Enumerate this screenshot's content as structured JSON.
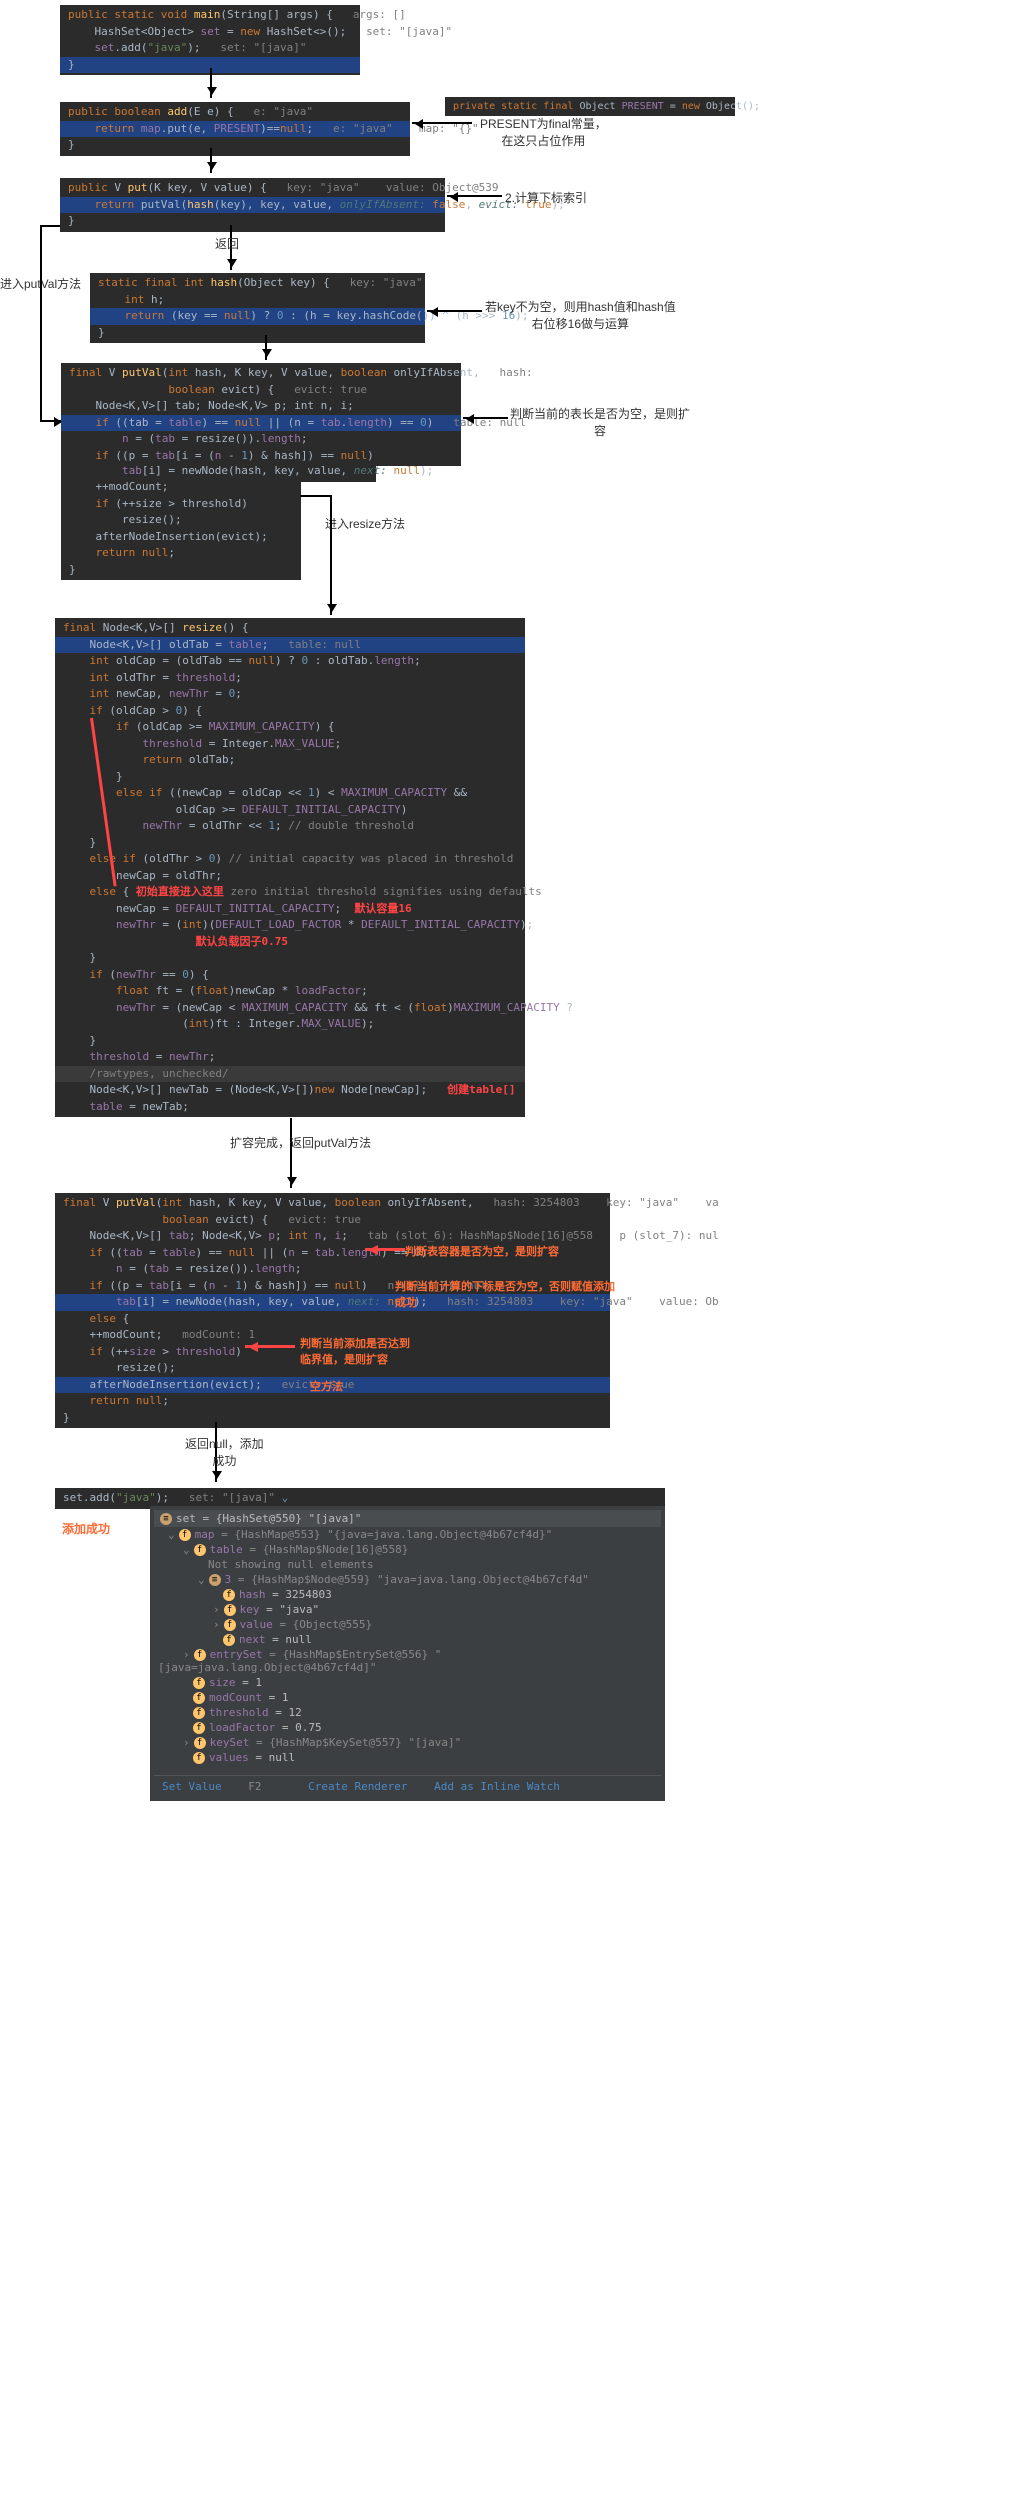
{
  "block1": {
    "l1a": "public static void",
    "l1b": "main",
    "l1c": "(String[] args) {",
    "l1d": "args: []",
    "l2a": "HashSet<Object>",
    "l2b": "set",
    "l2c": " = ",
    "l2d": "new",
    "l2e": " HashSet<>();",
    "l2f": "set: \"[java]\"",
    "l3a": "set",
    "l3b": ".add(",
    "l3c": "\"java\"",
    "l3d": ");",
    "l3e": "set: \"[java]\"",
    "l4": "}"
  },
  "block2": {
    "l1a": "public boolean",
    "l1b": "add",
    "l1c": "(E e) {",
    "l1d": "e: \"java\"",
    "l2a": "return",
    "l2b": "map",
    "l2c": ".put(e, ",
    "l2d": "PRESENT",
    "l2e": ")==",
    "l2f": "null",
    "l2g": ";",
    "l2h": "e: \"java\"    map: \"{}\"",
    "l3": "}"
  },
  "block2b": {
    "l1a": "private static final",
    "l1b": " Object ",
    "l1c": "PRESENT",
    "l1d": " = ",
    "l1e": "new",
    "l1f": " Object();"
  },
  "label2": "PRESENT为final常量，\n在这只占位作用",
  "block3": {
    "l1a": "public",
    "l1b": " V ",
    "l1c": "put",
    "l1d": "(K key, V value) {",
    "l1e": "key: \"java\"    value: Object@539",
    "l2a": "return",
    "l2b": " putVal(",
    "l2c": "hash",
    "l2d": "(key), key, value, ",
    "l2e": "onlyIfAbsent:",
    "l2f": "false",
    "l2g": ", ",
    "l2h": "evict:",
    "l2i": "true",
    "l2j": ");",
    "l3": "}"
  },
  "label3": "2.计算下标索引",
  "label_return": "返回",
  "label_enter_putval": "进入putVal方法",
  "block4": {
    "l1a": "static final int",
    "l1b": "hash",
    "l1c": "(Object key) {",
    "l1d": "key: \"java\"",
    "l2a": "int",
    "l2b": " h;",
    "l3a": "return",
    "l3b": " (key == ",
    "l3c": "null",
    "l3d": ") ? ",
    "l3e": "0",
    "l3f": " : (h = key.hashCode()) ^ (h >>> ",
    "l3g": "16",
    "l3h": ");",
    "l4": "}"
  },
  "label4": "若key不为空，则用hash值和hash值\n右位移16做与运算",
  "block5": {
    "l1a": "final",
    "l1b": " V ",
    "l1c": "putVal",
    "l1d": "(",
    "l1e": "int",
    "l1f": " hash, K key, V value, ",
    "l1g": "boolean",
    "l1h": " onlyIfAbsent,",
    "l1i": "hash:",
    "l2a": "boolean",
    "l2b": " evict) {",
    "l2c": "evict: true",
    "l3": "Node<K,V>[] tab; Node<K,V> p; int n, i;",
    "l4a": "if",
    "l4b": " ((tab = ",
    "l4c": "table",
    "l4d": ") == ",
    "l4e": "null",
    "l4f": " || (n = ",
    "l4g": "tab",
    "l4h": ".",
    "l4i": "length",
    "l4j": ") == ",
    "l4k": "0",
    "l4l": ")",
    "l4m": "table: null",
    "l5a": "n",
    "l5b": " = (",
    "l5c": "tab",
    "l5d": " = resize()).",
    "l5e": "length",
    "l5f": ";",
    "l6a": "if",
    "l6b": " ((p = ",
    "l6c": "tab",
    "l6d": "[i = (",
    "l6e": "n",
    "l6f": " - ",
    "l6g": "1",
    "l6h": ") & hash]) == ",
    "l6i": "null",
    "l6j": ")",
    "l7a": "tab",
    "l7b": "[i] = newNode(hash, key, value, ",
    "l7c": "next:",
    "l7d": "null",
    "l7e": ");",
    "l8": "++modCount;",
    "l9a": "if",
    "l9b": " (++size > threshold)",
    "l10": "resize();",
    "l11": "afterNodeInsertion(evict);",
    "l12a": "return null",
    "l12b": ";",
    "l13": "}"
  },
  "label5": "判断当前的表长是否为空，是则扩\n容",
  "label_enter_resize": "进入resize方法",
  "block6": {
    "l1a": "final",
    "l1b": " Node<K,V>[] ",
    "l1c": "resize",
    "l1d": "() {",
    "l2a": "Node<K,V>[] oldTab = ",
    "l2b": "table",
    "l2c": ";",
    "l2d": "table: null",
    "l3a": "int",
    "l3b": " oldCap = (oldTab == ",
    "l3c": "null",
    "l3d": ") ? ",
    "l3e": "0",
    "l3f": " : oldTab.",
    "l3g": "length",
    "l3h": ";",
    "l4a": "int",
    "l4b": " oldThr = ",
    "l4c": "threshold",
    "l4d": ";",
    "l5a": "int",
    "l5b": " newCap, ",
    "l5c": "newThr",
    "l5d": " = ",
    "l5e": "0",
    "l5f": ";",
    "l6a": "if",
    "l6b": " (oldCap > ",
    "l6c": "0",
    "l6d": ") {",
    "l7a": "if",
    "l7b": " (oldCap >= ",
    "l7c": "MAXIMUM_CAPACITY",
    "l7d": ") {",
    "l8a": "threshold",
    "l8b": " = Integer.",
    "l8c": "MAX_VALUE",
    "l8d": ";",
    "l9a": "return",
    "l9b": " oldTab;",
    "l10": "}",
    "l11a": "else if",
    "l11b": " ((newCap = oldCap << ",
    "l11c": "1",
    "l11d": ") < ",
    "l11e": "MAXIMUM_CAPACITY",
    "l11f": " &&",
    "l12a": "oldCap >= ",
    "l12b": "DEFAULT_INITIAL_CAPACITY",
    "l12c": ")",
    "l13a": "newThr",
    "l13b": " = oldThr << ",
    "l13c": "1",
    "l13d": "; ",
    "l13e": "// double threshold",
    "l14": "}",
    "l15a": "else if",
    "l15b": " (oldThr > ",
    "l15c": "0",
    "l15d": ") ",
    "l15e": "// initial capacity was placed in threshold",
    "l16": "newCap = oldThr;",
    "l17a": "else",
    "l17b": " {",
    "l17c": "初始直接进入这里",
    "l17d": "zero initial threshold signifies using defaults",
    "l18a": "newCap = ",
    "l18b": "DEFAULT_INITIAL_CAPACITY",
    "l18c": ";",
    "l18d": "默认容量16",
    "l19a": "newThr",
    "l19b": " = (",
    "l19c": "int",
    "l19d": ")(",
    "l19e": "DEFAULT_LOAD_FACTOR",
    "l19f": " * ",
    "l19g": "DEFAULT_INITIAL_CAPACITY",
    "l19h": ");",
    "l19i": "默认负载因子0.75",
    "l20": "}",
    "l21a": "if",
    "l21b": " (",
    "l21c": "newThr",
    "l21d": " == ",
    "l21e": "0",
    "l21f": ") {",
    "l22a": "float",
    "l22b": " ft = (",
    "l22c": "float",
    "l22d": ")newCap * ",
    "l22e": "loadFactor",
    "l22f": ";",
    "l23a": "newThr",
    "l23b": " = (newCap < ",
    "l23c": "MAXIMUM_CAPACITY",
    "l23d": " && ft < (",
    "l23e": "float",
    "l23f": ")",
    "l23g": "MAXIMUM_CAPACITY",
    "l23h": " ?",
    "l24a": "(",
    "l24b": "int",
    "l24c": ")ft : Integer.",
    "l24d": "MAX_VALUE",
    "l24e": ");",
    "l25": "}",
    "l26a": "threshold",
    "l26b": " = ",
    "l26c": "newThr",
    "l26d": ";",
    "l27": "/rawtypes, unchecked/",
    "l28a": "Node<K,V>[] newTab = (Node<K,V>[])",
    "l28b": "new",
    "l28c": " Node[newCap];",
    "l28d": "创建table[]",
    "l29a": "table",
    "l29b": " = newTab;"
  },
  "label_resize_done": "扩容完成，返回putVal方法",
  "block7": {
    "l1a": "final",
    "l1b": " V ",
    "l1c": "putVal",
    "l1d": "(",
    "l1e": "int",
    "l1f": " hash, K key, V value, ",
    "l1g": "boolean",
    "l1h": " onlyIfAbsent,",
    "l1i": "hash: 3254803    key: \"java\"    va",
    "l2a": "boolean",
    "l2b": " evict) {",
    "l2c": "evict: true",
    "l3a": "Node<K,V>[] ",
    "l3b": "tab",
    "l3c": "; Node<K,V> ",
    "l3d": "p",
    "l3e": "; ",
    "l3f": "int",
    "l3g": " ",
    "l3h": "n",
    "l3i": ", ",
    "l3j": "i",
    "l3k": ";",
    "l3l": "tab (slot_6): HashMap$Node[16]@558    p (slot_7): nul",
    "l4a": "if",
    "l4b": " ((",
    "l4c": "tab",
    "l4d": " = ",
    "l4e": "table",
    "l4f": ") == ",
    "l4g": "null",
    "l4h": " || (",
    "l4i": "n",
    "l4j": " = ",
    "l4k": "tab",
    "l4l": ".",
    "l4m": "length",
    "l4n": ") == ",
    "l4o": "0",
    "l4p": ")",
    "l4q": "判断表容器是否为空，是则扩容",
    "l5a": "n",
    "l5b": " = (",
    "l5c": "tab",
    "l5d": " = resize()).",
    "l5e": "length",
    "l5f": ";",
    "l6a": "if",
    "l6b": " ((p = ",
    "l6c": "tab",
    "l6d": "[i = (",
    "l6e": "n",
    "l6f": " - ",
    "l6g": "1",
    "l6h": ") & hash]) == ",
    "l6i": "null",
    "l6j": ")",
    "l6k": "n (slot_7): null",
    "l7a": "tab",
    "l7b": "[i] = newNode(hash, key, value, ",
    "l7c": "next:",
    "l7d": "null",
    "l7e": ");",
    "l7f": "判断当前计算的下标是否为空，否则赋值添加\n成功",
    "l8a": "else",
    "l8b": " {",
    "l9a": "++modCount;",
    "l9b": "modCount: 1",
    "l10a": "if",
    "l10b": " (++",
    "l10c": "size",
    "l10d": " > ",
    "l10e": "threshold",
    "l10f": ")",
    "l10g": "判断当前添加是否达到\n临界值，是则扩容",
    "l11": "resize();",
    "l12a": "afterNodeInsertion(evict);",
    "l12b": "evict: true",
    "l12c": "空方法",
    "l13a": "return null",
    "l13b": ";",
    "l14": "}"
  },
  "label_return_null": "返回null，添加\n成功",
  "block8": {
    "l1a": "set.add(",
    "l1b": "\"java\"",
    "l1c": ");",
    "l1d": "set: \"[java]\""
  },
  "label_add_ok": "添加成功",
  "dbg": {
    "head": "set = {HashSet@550}  \"[java]\"",
    "r1": {
      "name": "map",
      "val": " = {HashMap@553} \"{java=java.lang.Object@4b67cf4d}\""
    },
    "r2": {
      "name": "table",
      "val": " = {HashMap$Node[16]@558}"
    },
    "r3": "Not showing null elements",
    "r4": {
      "name": "3",
      "val": " = {HashMap$Node@559} \"java=java.lang.Object@4b67cf4d\""
    },
    "r5": {
      "name": "hash",
      "val": " = 3254803"
    },
    "r6": {
      "name": "key",
      "val": " = \"java\""
    },
    "r7": {
      "name": "value",
      "val": " = {Object@555}"
    },
    "r8": {
      "name": "next",
      "val": " = null"
    },
    "r9": {
      "name": "entrySet",
      "val": " = {HashMap$EntrySet@556} \"[java=java.lang.Object@4b67cf4d]\""
    },
    "r10": {
      "name": "size",
      "val": " = 1"
    },
    "r11": {
      "name": "modCount",
      "val": " = 1"
    },
    "r12": {
      "name": "threshold",
      "val": " = 12"
    },
    "r13": {
      "name": "loadFactor",
      "val": " = 0.75"
    },
    "r14": {
      "name": "keySet",
      "val": " = {HashMap$KeySet@557} \"[java]\""
    },
    "r15": {
      "name": "values",
      "val": " = null"
    },
    "f1": "Set Value",
    "f1k": "F2",
    "f2": "Create Renderer",
    "f3": "Add as Inline Watch"
  }
}
